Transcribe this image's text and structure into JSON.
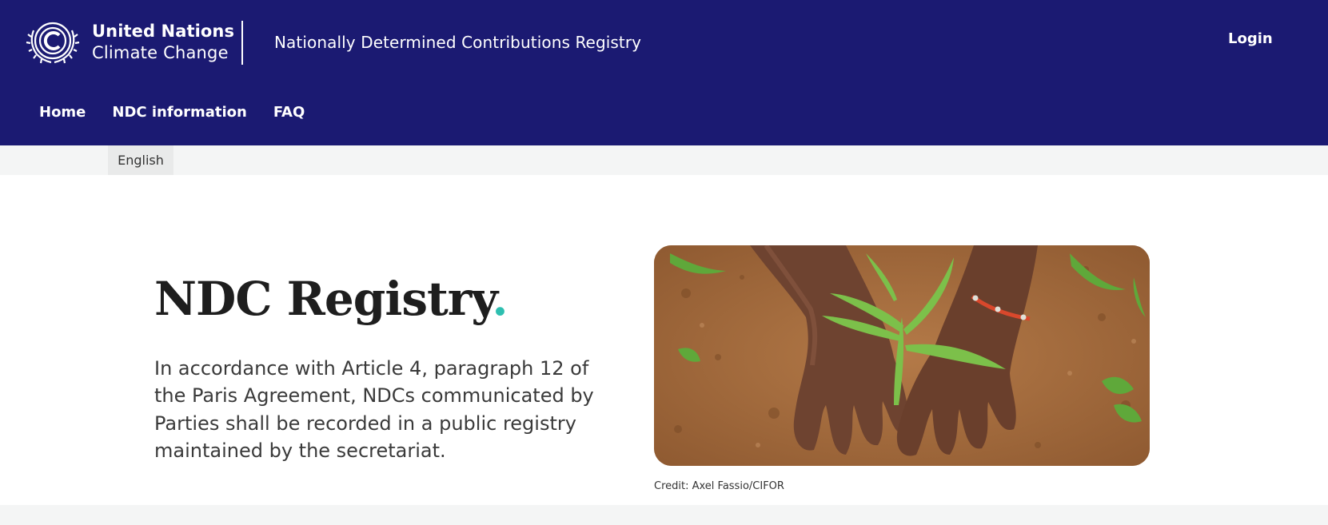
{
  "header": {
    "org_name_line1": "United Nations",
    "org_name_line2": "Climate Change",
    "site_title": "Nationally Determined Contributions Registry",
    "login_label": "Login",
    "background_color": "#1b1a72",
    "logo_icon": "un-climate-change-emblem-icon"
  },
  "nav": {
    "items": [
      {
        "label": "Home"
      },
      {
        "label": "NDC information"
      },
      {
        "label": "FAQ"
      }
    ]
  },
  "language": {
    "selected": "English"
  },
  "hero": {
    "title": "NDC Registry",
    "title_dot": ".",
    "accent_color": "#2ebfb0",
    "description": "In accordance with Article 4, paragraph 12 of the Paris Agreement, NDCs communicated by Parties shall be recorded in a public registry maintained by the secretariat.",
    "image_subject": "hands-planting-seedling-in-soil",
    "image_credit": "Credit: Axel Fassio/CIFOR"
  }
}
